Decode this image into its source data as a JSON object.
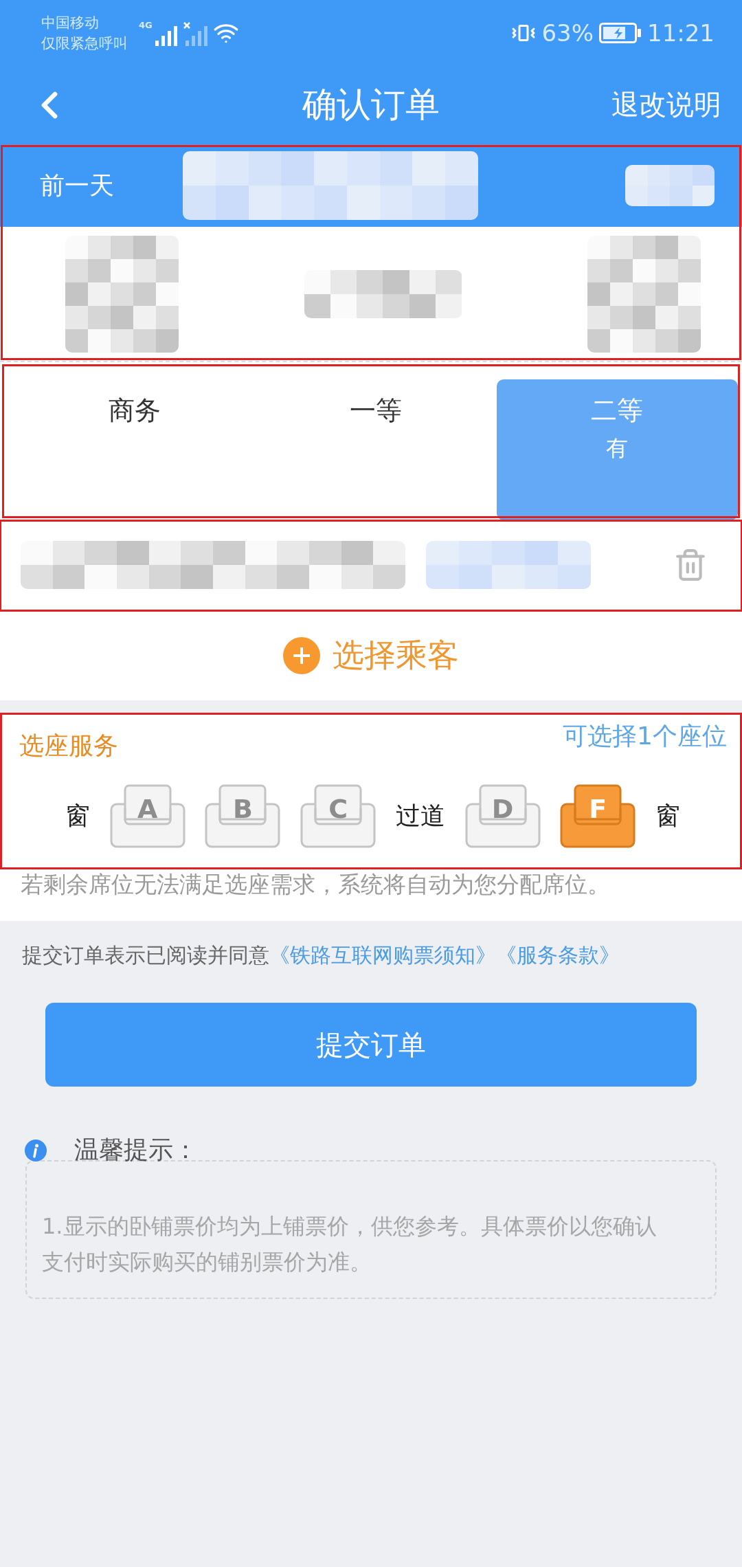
{
  "status_bar": {
    "carrier": "中国移动",
    "carrier_note": "仅限紧急呼叫",
    "network": "4G",
    "battery_percent": "63%",
    "time": "11:21"
  },
  "nav": {
    "title": "确认订单",
    "action": "退改说明"
  },
  "trip": {
    "prev_day": "前一天",
    "highlighted": true
  },
  "seat_classes": {
    "highlighted": true,
    "items": [
      {
        "name": "商务",
        "selected": false
      },
      {
        "name": "一等",
        "selected": false
      },
      {
        "name": "二等",
        "availability": "有",
        "selected": true
      }
    ]
  },
  "passengers": {
    "highlighted": true,
    "add_label": "选择乘客"
  },
  "seat_service": {
    "highlighted": true,
    "title": "选座服务",
    "hint": "可选择1个座位",
    "seats": [
      {
        "kind": "label",
        "text": "窗"
      },
      {
        "kind": "seat",
        "text": "A",
        "selected": false
      },
      {
        "kind": "seat",
        "text": "B",
        "selected": false
      },
      {
        "kind": "seat",
        "text": "C",
        "selected": false
      },
      {
        "kind": "label",
        "text": "过道"
      },
      {
        "kind": "seat",
        "text": "D",
        "selected": false
      },
      {
        "kind": "seat",
        "text": "F",
        "selected": true
      },
      {
        "kind": "label",
        "text": "窗"
      }
    ],
    "note": "若剩余席位无法满足选座需求，系统将自动为您分配席位。"
  },
  "agreement": {
    "text": "提交订单表示已阅读并同意",
    "links": [
      "《铁路互联网购票须知》",
      "《服务条款》"
    ]
  },
  "submit": "提交订单",
  "tips": {
    "title": "温馨提示：",
    "items": [
      "1.显示的卧铺票价均为上铺票价，供您参考。具体票价以您确认支付时实际购买的铺别票价为准。"
    ]
  }
}
